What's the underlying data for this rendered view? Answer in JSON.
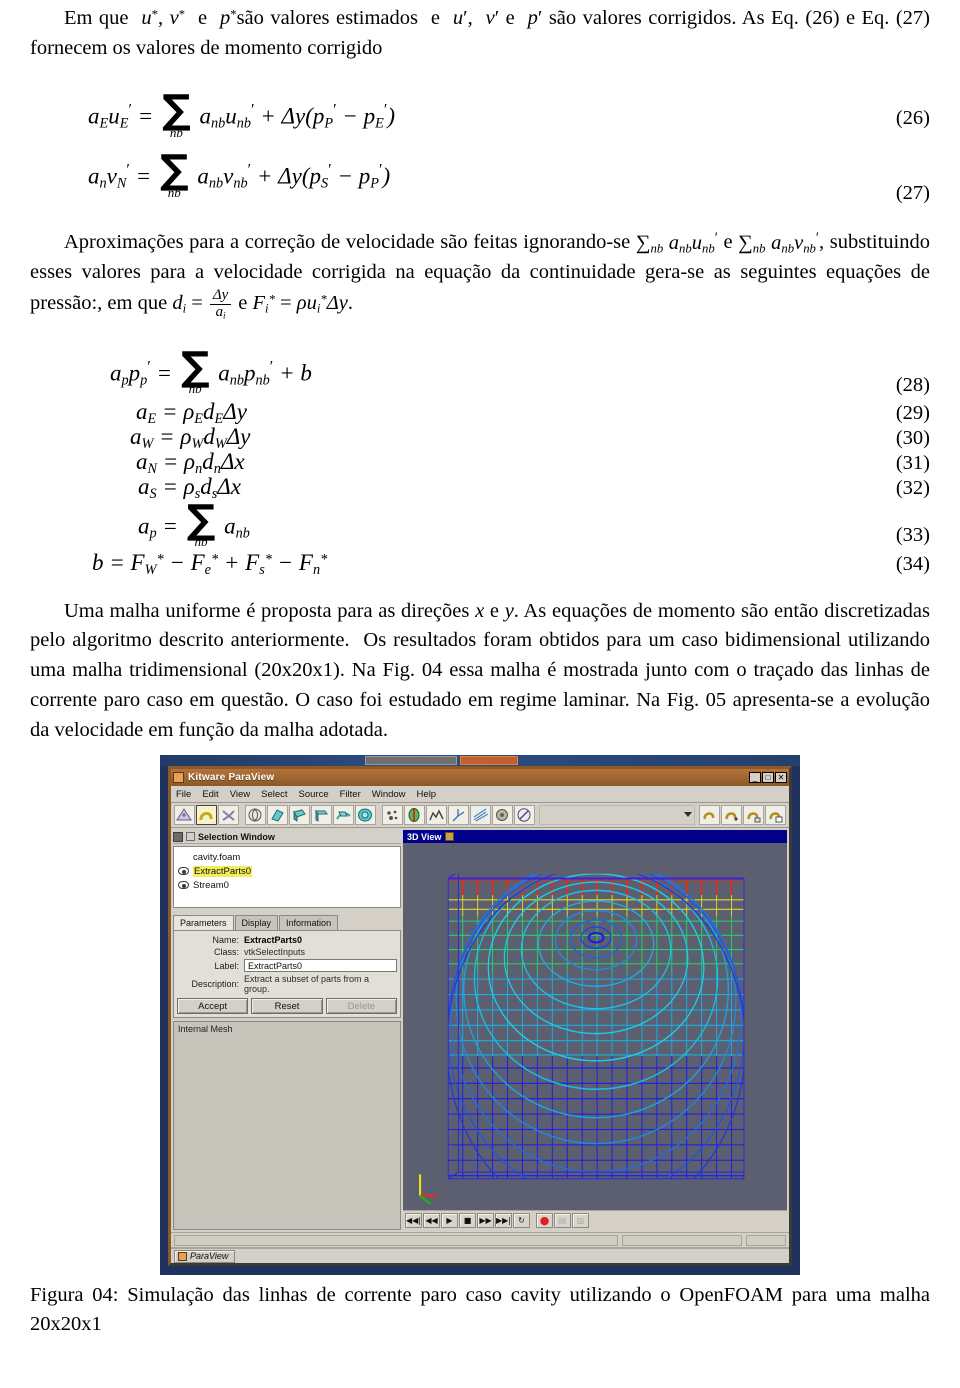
{
  "document": {
    "paragraph_1": {
      "parts": [
        "Em que ",
        "u*",
        ", ",
        "v*",
        " e ",
        "p*",
        "são valores estimados  e ",
        "u′",
        ", ",
        "v′",
        " e ",
        "p′",
        " são valores corrigidos. As Eq. (26) e Eq. (27) fornecem os valores de momento corrigido"
      ],
      "text": "Em que u*, v* e p* são valores estimados e u′, v′ e p′ são valores corrigidos. As Eq. (26) e Eq. (27) fornecem os valores de momento corrigido"
    },
    "equations_group_1": [
      {
        "number": "(26)",
        "lhs": "a_E u'_E",
        "rhs": "Σ_nb a_nb u'_nb + Δy(p'_P − p'_E)"
      },
      {
        "number": "(27)",
        "lhs": "a_n v'_N",
        "rhs": "Σ_nb a_nb v'_nb + Δy(p'_S − p'_P)"
      }
    ],
    "paragraph_2": {
      "text": "Aproximações para a correção de velocidade são feitas ignorando-se Σnb anb u'nb e Σnb anb v'nb, substituindo esses valores para a velocidade corrigida na equação da continuidade gera-se as seguintes equações de pressão:, em que di = Δy/ai e F*i = ρu*i Δy."
    },
    "equations_group_2": [
      {
        "number": "(28)",
        "formula": "a_p p'_p = Σ_nb a_nb p'_nb + b"
      },
      {
        "number": "(29)",
        "formula": "a_E = ρ_E d_E Δy"
      },
      {
        "number": "(30)",
        "formula": "a_W = ρ_W d_W Δy"
      },
      {
        "number": "(31)",
        "formula": "a_N = ρ_n d_n Δx"
      },
      {
        "number": "(32)",
        "formula": "a_S = ρ_s d_s Δx"
      },
      {
        "number": "(33)",
        "formula": "a_p = Σ_nb a_nb"
      },
      {
        "number": "(34)",
        "formula": "b = F*_W − F*_e + F*_s − F*_n"
      }
    ],
    "paragraph_3": {
      "text": "Uma malha uniforme é proposta para as direções x e y. As equações de momento são então discretizadas pelo algoritmo descrito anteriormente.  Os resultados foram obtidos para um caso bidimensional utilizando uma malha tridimensional (20x20x1). Na Fig. 04 essa malha é mostrada junto com o traçado das linhas de corrente paro caso em questão. O caso foi estudado em regime laminar. Na Fig. 05 apresenta-se a evolução da velocidade em função da malha adotada."
    },
    "figure_caption": "Figura 04: Simulação das linhas de corrente paro caso cavity utilizando o OpenFOAM para uma malha 20x20x1"
  },
  "screenshot": {
    "window": {
      "title": "Kitware ParaView",
      "buttons": {
        "minimize": "_",
        "maximize": "□",
        "close": "✕"
      }
    },
    "menubar": [
      {
        "label": "File"
      },
      {
        "label": "Edit"
      },
      {
        "label": "View"
      },
      {
        "label": "Select"
      },
      {
        "label": "Source"
      },
      {
        "label": "Filter"
      },
      {
        "label": "Window"
      },
      {
        "label": "Help"
      }
    ],
    "left_panel": {
      "header": "Selection Window",
      "tree": [
        {
          "label": "cavity.foam",
          "highlighted": false,
          "has_eye": false
        },
        {
          "label": "ExtractParts0",
          "highlighted": true,
          "has_eye": true
        },
        {
          "label": "Stream0",
          "highlighted": false,
          "has_eye": true
        }
      ],
      "tabs": [
        {
          "label": "Parameters",
          "active": true
        },
        {
          "label": "Display",
          "active": false
        },
        {
          "label": "Information",
          "active": false
        }
      ],
      "properties": [
        {
          "label": "Name:",
          "value": "ExtractParts0"
        },
        {
          "label": "Class:",
          "value": "vtkSelectInputs"
        },
        {
          "label": "Label:",
          "value": "ExtractParts0"
        },
        {
          "label": "Description:",
          "value": "Extract a subset of parts from a group."
        }
      ],
      "buttons": [
        {
          "label": "Accept",
          "enabled": true
        },
        {
          "label": "Reset",
          "enabled": true
        },
        {
          "label": "Delete",
          "enabled": false
        }
      ],
      "mesh_list": [
        "Internal Mesh"
      ]
    },
    "render_view": {
      "title": "3D View",
      "background_color": "#5c5f70",
      "mesh_color": "#2020e0",
      "streamline_colors": [
        "#0000ff",
        "#0066ff",
        "#00d8ff",
        "#00ff88",
        "#b4ff00",
        "#ff2000"
      ]
    },
    "vcr_controls": [
      {
        "name": "first-frame",
        "glyph": "◀◀|"
      },
      {
        "name": "previous-frame",
        "glyph": "◀◀"
      },
      {
        "name": "play",
        "glyph": "▶"
      },
      {
        "name": "stop",
        "glyph": "■"
      },
      {
        "name": "next-frame",
        "glyph": "▶▶"
      },
      {
        "name": "last-frame",
        "glyph": "▶▶|"
      },
      {
        "name": "loop",
        "glyph": "↻"
      },
      {
        "name": "record",
        "glyph": "●"
      },
      {
        "name": "save-animation",
        "glyph": "▤"
      },
      {
        "name": "time-settings",
        "glyph": "▥"
      }
    ],
    "taskbar": {
      "item_label": "ParaView"
    }
  }
}
